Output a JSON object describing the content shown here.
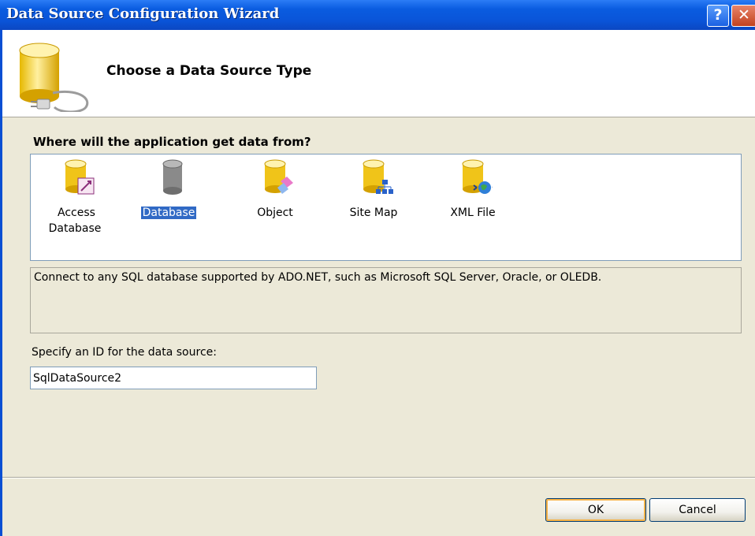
{
  "window": {
    "title": "Data Source Configuration Wizard"
  },
  "titlebar": {
    "help_label": "?",
    "close_label": "✕",
    "help_icon": "help-icon",
    "close_icon": "close-icon"
  },
  "header": {
    "heading": "Choose a Data Source Type",
    "icon": "database-plug-icon"
  },
  "prompt": "Where will the application get data from?",
  "source_types": [
    {
      "label": "Access Database",
      "icon": "access-database-icon",
      "selected": false
    },
    {
      "label": "Database",
      "icon": "database-icon",
      "selected": true
    },
    {
      "label": "Object",
      "icon": "object-icon",
      "selected": false
    },
    {
      "label": "Site Map",
      "icon": "site-map-icon",
      "selected": false
    },
    {
      "label": "XML File",
      "icon": "xml-file-icon",
      "selected": false
    }
  ],
  "description": "Connect to any SQL database supported by ADO.NET, such as Microsoft SQL Server, Oracle, or OLEDB.",
  "id_field": {
    "label": "Specify an ID for the data source:",
    "value": "SqlDataSource2"
  },
  "buttons": {
    "ok": "OK",
    "cancel": "Cancel"
  },
  "colors": {
    "titlebar": "#0a54d8",
    "selection": "#316ac5",
    "dialog_bg": "#ece9d8",
    "cylinder": "#f0c419"
  }
}
